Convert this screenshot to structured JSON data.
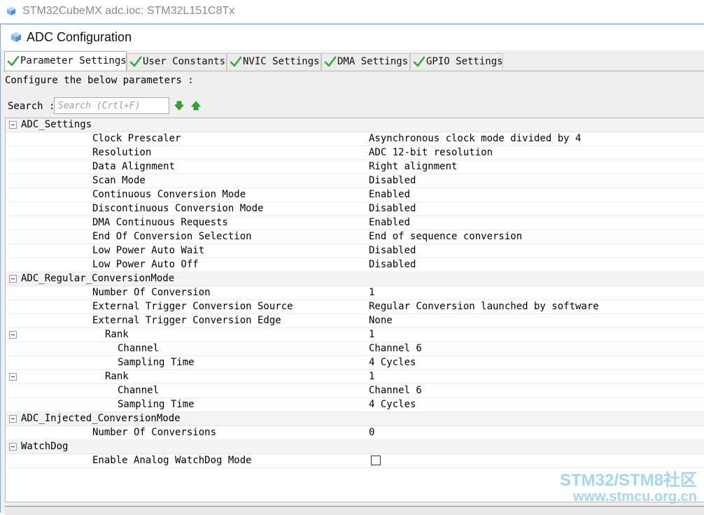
{
  "window": {
    "title": "STM32CubeMX adc.ioc: STM32L151C8Tx"
  },
  "dialog": {
    "title": "ADC Configuration"
  },
  "tabs": [
    {
      "label": "Parameter Settings"
    },
    {
      "label": "User Constants"
    },
    {
      "label": "NVIC Settings"
    },
    {
      "label": "DMA Settings"
    },
    {
      "label": "GPIO Settings"
    }
  ],
  "configure_label": "Configure the below parameters :",
  "search": {
    "label": "Search :",
    "placeholder": "Search (Crtl+F)"
  },
  "groups": {
    "adc_settings": {
      "name": "ADC_Settings",
      "params": [
        {
          "name": "Clock Prescaler",
          "value": "Asynchronous clock mode divided by 4"
        },
        {
          "name": "Resolution",
          "value": "ADC 12-bit resolution"
        },
        {
          "name": "Data Alignment",
          "value": "Right alignment"
        },
        {
          "name": "Scan Mode",
          "value": "Disabled"
        },
        {
          "name": "Continuous Conversion Mode",
          "value": "Enabled"
        },
        {
          "name": "Discontinuous Conversion Mode",
          "value": "Disabled"
        },
        {
          "name": "DMA Continuous Requests",
          "value": "Enabled"
        },
        {
          "name": "End Of Conversion Selection",
          "value": "End of sequence conversion"
        },
        {
          "name": "Low Power Auto Wait",
          "value": "Disabled"
        },
        {
          "name": "Low Power Auto Off",
          "value": "Disabled"
        }
      ]
    },
    "regular": {
      "name": "ADC_Regular_ConversionMode",
      "params": [
        {
          "name": "Number Of Conversion",
          "value": "1"
        },
        {
          "name": "External Trigger Conversion Source",
          "value": "Regular Conversion launched by software"
        },
        {
          "name": "External Trigger Conversion Edge",
          "value": "None"
        }
      ],
      "ranks": [
        {
          "name": "Rank",
          "value": "1",
          "channel_label": "Channel",
          "channel_value": "Channel 6",
          "sampling_label": "Sampling Time",
          "sampling_value": "4 Cycles"
        },
        {
          "name": "Rank",
          "value": "1",
          "channel_label": "Channel",
          "channel_value": "Channel 6",
          "sampling_label": "Sampling Time",
          "sampling_value": "4 Cycles"
        }
      ]
    },
    "injected": {
      "name": "ADC_Injected_ConversionMode",
      "params": [
        {
          "name": "Number Of Conversions",
          "value": "0"
        }
      ]
    },
    "watchdog": {
      "name": "WatchDog",
      "params": [
        {
          "name": "Enable Analog WatchDog Mode",
          "checked": false
        }
      ]
    }
  },
  "watermark": {
    "line1": "STM32/STM8社区",
    "line2": "www.stmcu.org.cn"
  },
  "colors": {
    "check_green": "#3aa63a",
    "arrow_green": "#2ea82e",
    "icon_blue": "#4a8fd9",
    "watermark": "#a8d6ec"
  }
}
